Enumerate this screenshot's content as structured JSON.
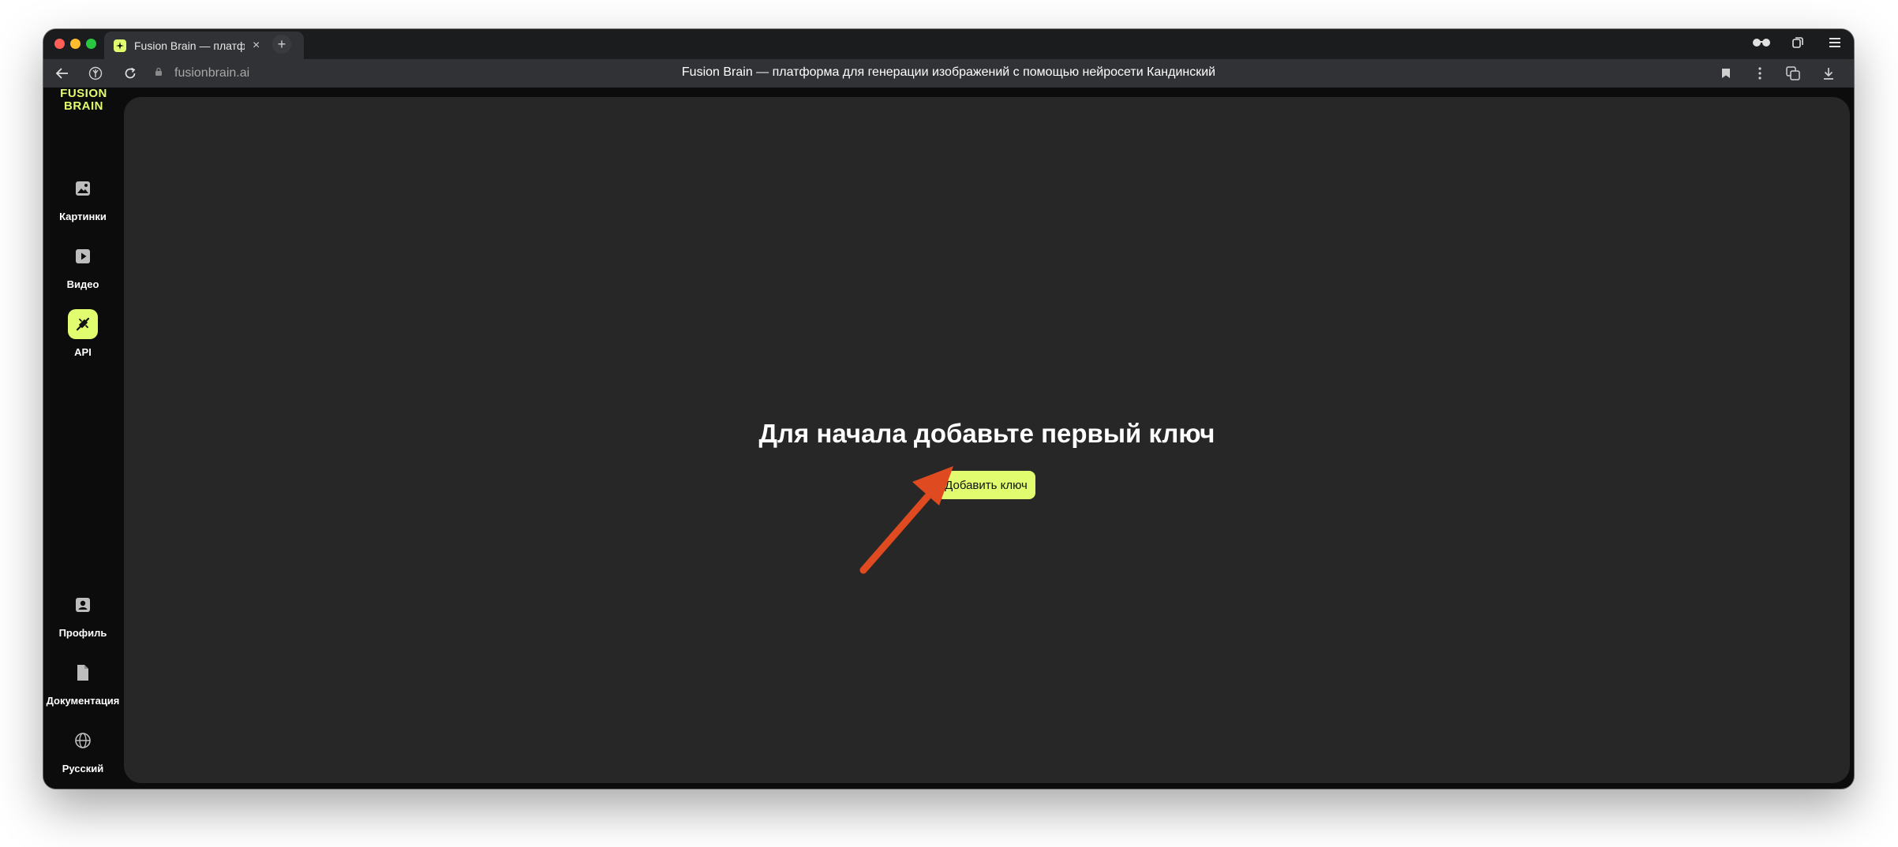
{
  "browser": {
    "tab_title": "Fusion Brain — платформа для генерации изображений с помощью нейросети Кандинский",
    "tab_close": "×",
    "new_tab": "+",
    "url": "fusionbrain.ai",
    "page_title": "Fusion Brain — платформа для генерации изображений с помощью нейросети Кандинский"
  },
  "sidebar": {
    "logo": "FUSION BRAIN",
    "items": [
      {
        "label": "Картинки",
        "icon": "image-icon",
        "active": false
      },
      {
        "label": "Видео",
        "icon": "play-icon",
        "active": false
      },
      {
        "label": "API",
        "icon": "plug-icon",
        "active": true
      },
      {
        "label": "Профиль",
        "icon": "profile-icon",
        "active": false
      },
      {
        "label": "Документация",
        "icon": "document-icon",
        "active": false
      },
      {
        "label": "Русский",
        "icon": "globe-icon",
        "active": false
      }
    ]
  },
  "main": {
    "empty_title": "Для начала добавьте первый ключ",
    "add_key_label": "Добавить ключ"
  },
  "colors": {
    "accent": "#e1fc6e",
    "panel": "#272727",
    "sidebar": "#0c0c0c",
    "annotation_arrow": "#e04a20"
  }
}
